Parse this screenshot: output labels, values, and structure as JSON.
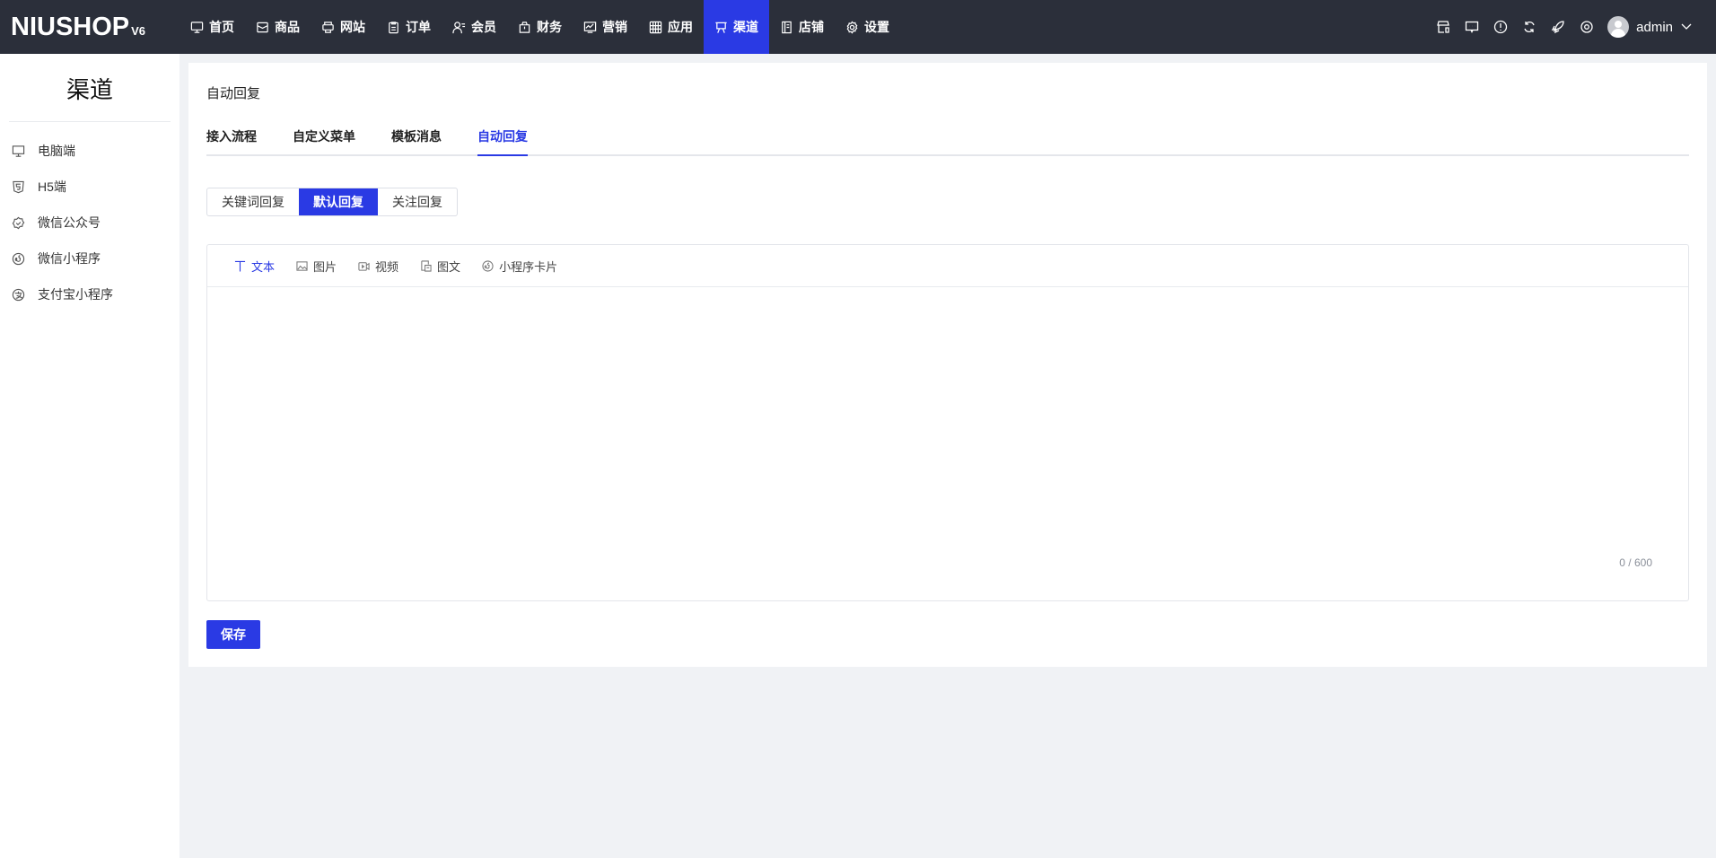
{
  "header": {
    "logo": "NIUSHOP",
    "logo_version": "V6",
    "nav": [
      {
        "label": "首页",
        "icon": "monitor-icon"
      },
      {
        "label": "商品",
        "icon": "box-icon"
      },
      {
        "label": "网站",
        "icon": "printer-icon"
      },
      {
        "label": "订单",
        "icon": "clipboard-icon"
      },
      {
        "label": "会员",
        "icon": "user-icon"
      },
      {
        "label": "财务",
        "icon": "bag-icon"
      },
      {
        "label": "营销",
        "icon": "chart-icon"
      },
      {
        "label": "应用",
        "icon": "apps-icon"
      },
      {
        "label": "渠道",
        "icon": "board-icon",
        "active": true
      },
      {
        "label": "店铺",
        "icon": "book-icon"
      },
      {
        "label": "设置",
        "icon": "gear-icon"
      }
    ],
    "user": "admin",
    "accent": "#2a3ae4"
  },
  "sidebar": {
    "title": "渠道",
    "items": [
      {
        "label": "电脑端"
      },
      {
        "label": "H5端"
      },
      {
        "label": "微信公众号"
      },
      {
        "label": "微信小程序"
      },
      {
        "label": "支付宝小程序"
      }
    ]
  },
  "main": {
    "title": "自动回复",
    "tabs": [
      {
        "label": "接入流程"
      },
      {
        "label": "自定义菜单"
      },
      {
        "label": "模板消息"
      },
      {
        "label": "自动回复",
        "active": true
      }
    ],
    "reply_types": [
      {
        "label": "关键词回复"
      },
      {
        "label": "默认回复",
        "active": true
      },
      {
        "label": "关注回复"
      }
    ],
    "editor_tools": [
      {
        "label": "文本",
        "active": true
      },
      {
        "label": "图片"
      },
      {
        "label": "视频"
      },
      {
        "label": "图文"
      },
      {
        "label": "小程序卡片"
      }
    ],
    "text_value": "",
    "counter": "0 / 600",
    "save_label": "保存"
  }
}
